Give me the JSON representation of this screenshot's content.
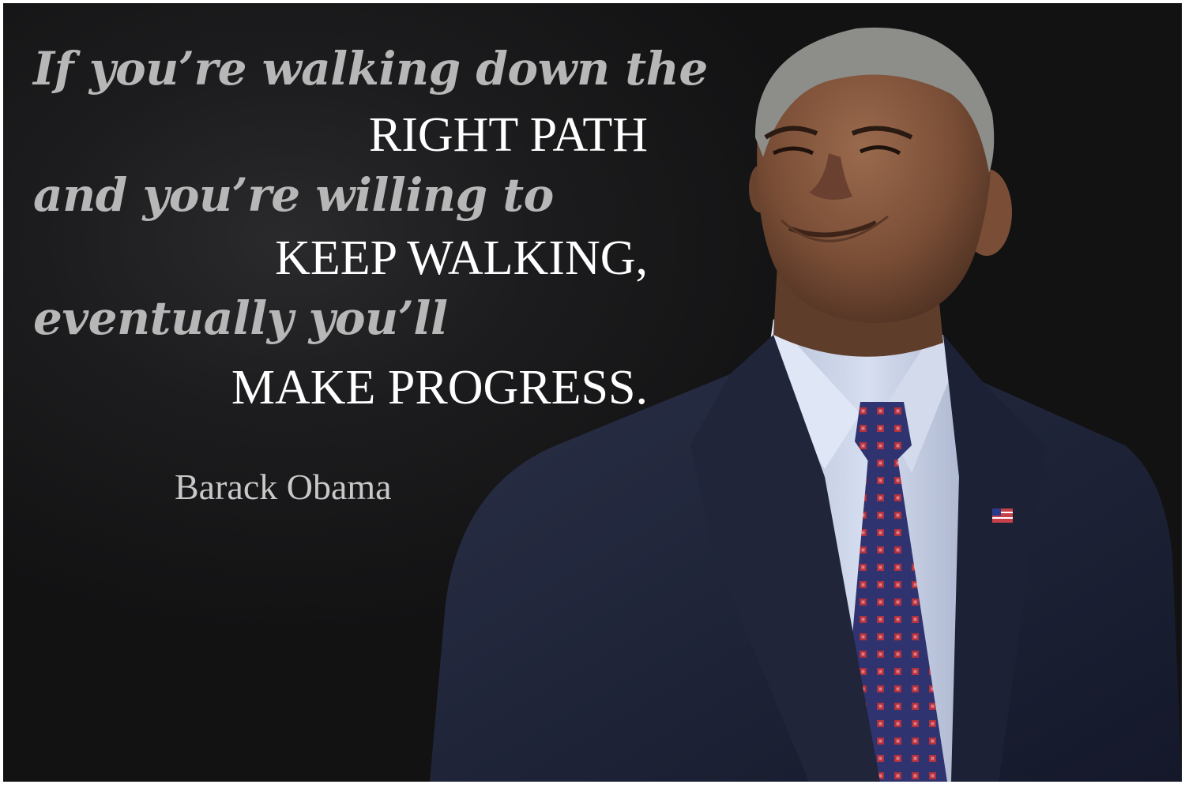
{
  "quote": {
    "line1": "If you’re walking down the",
    "line2": "RIGHT PATH",
    "line3": "and you’re willing to",
    "line4": "KEEP WALKING,",
    "line5": "eventually you’ll",
    "line6": "MAKE PROGRESS."
  },
  "author": "Barack Obama",
  "colors": {
    "background": "#161617",
    "italic_text": "#b7b7b7",
    "caps_text": "#ffffff",
    "author_text": "#c8c8c8",
    "suit": "#1f2436",
    "shirt": "#cdd6ea",
    "tie": "#2f3370",
    "tie_dots": "#b0323e"
  },
  "portrait": {
    "icon": "person-portrait-icon",
    "pin_icon": "flag-pin-icon"
  }
}
